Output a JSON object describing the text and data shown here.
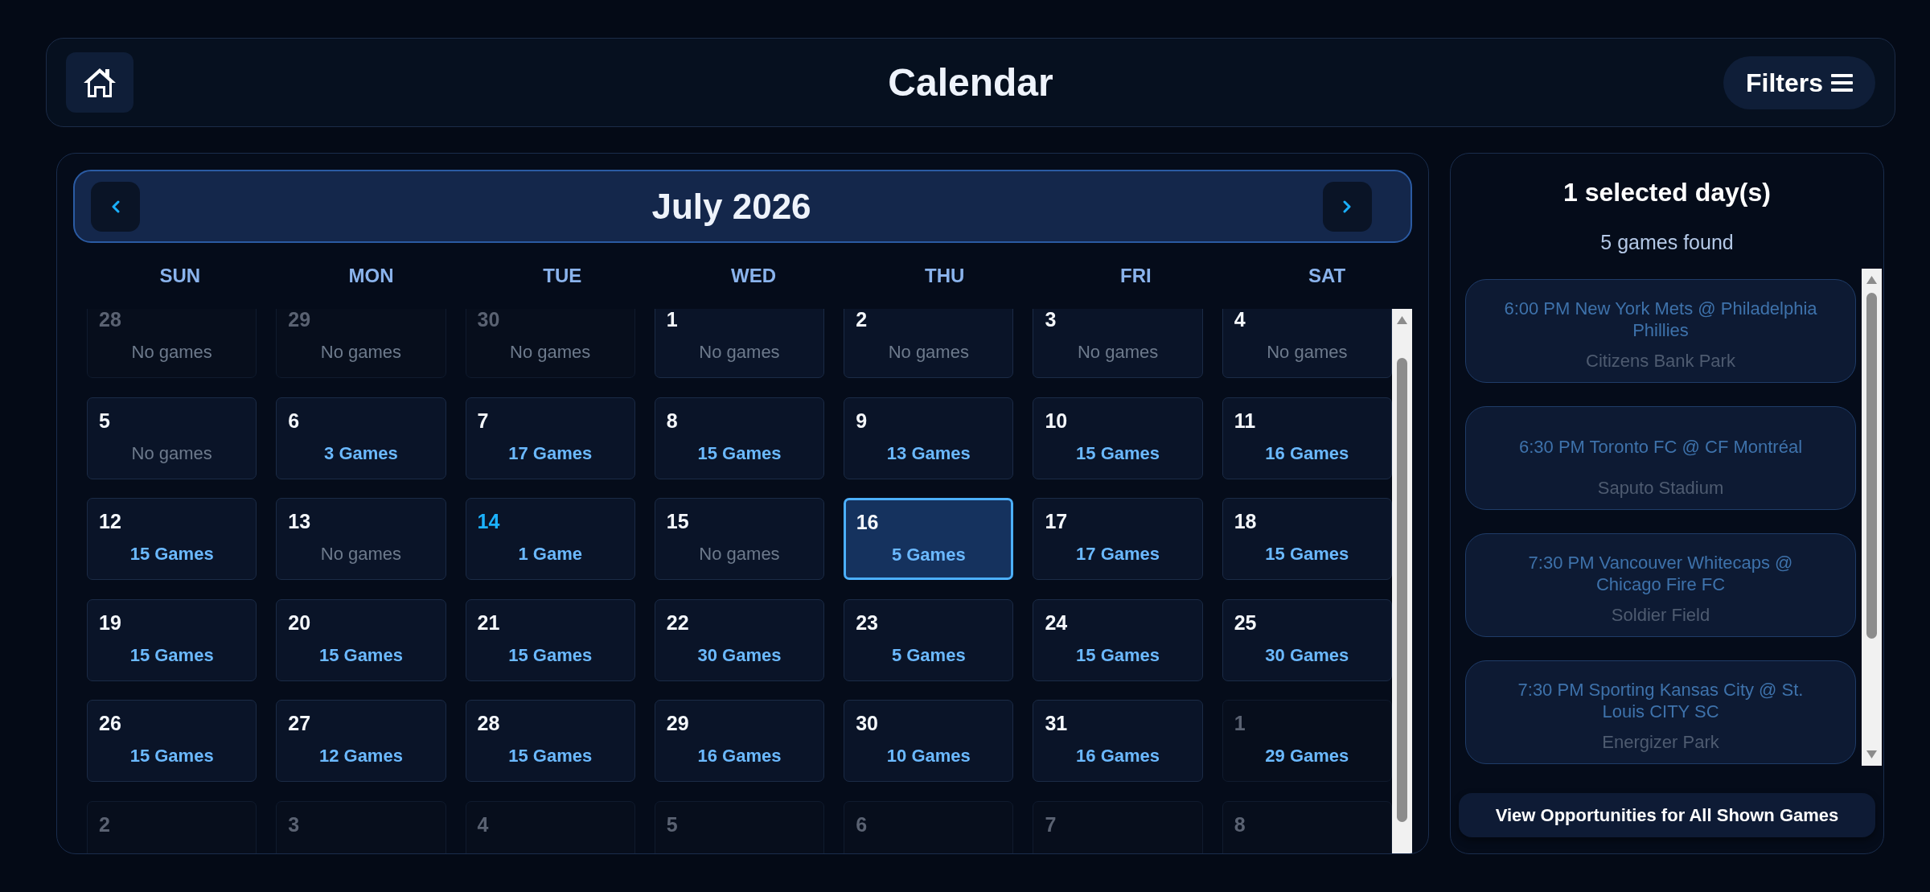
{
  "header": {
    "title": "Calendar",
    "filters_label": "Filters"
  },
  "calendar": {
    "month": "July 2026",
    "weekdays": [
      "SUN",
      "MON",
      "TUE",
      "WED",
      "THU",
      "FRI",
      "SAT"
    ],
    "weeks": [
      [
        {
          "day": "28",
          "games": "No games",
          "has_games": false,
          "in_month": false,
          "today": false,
          "selected": false
        },
        {
          "day": "29",
          "games": "No games",
          "has_games": false,
          "in_month": false,
          "today": false,
          "selected": false
        },
        {
          "day": "30",
          "games": "No games",
          "has_games": false,
          "in_month": false,
          "today": false,
          "selected": false
        },
        {
          "day": "1",
          "games": "No games",
          "has_games": false,
          "in_month": true,
          "today": false,
          "selected": false
        },
        {
          "day": "2",
          "games": "No games",
          "has_games": false,
          "in_month": true,
          "today": false,
          "selected": false
        },
        {
          "day": "3",
          "games": "No games",
          "has_games": false,
          "in_month": true,
          "today": false,
          "selected": false
        },
        {
          "day": "4",
          "games": "No games",
          "has_games": false,
          "in_month": true,
          "today": false,
          "selected": false
        }
      ],
      [
        {
          "day": "5",
          "games": "No games",
          "has_games": false,
          "in_month": true,
          "today": false,
          "selected": false
        },
        {
          "day": "6",
          "games": "3 Games",
          "has_games": true,
          "in_month": true,
          "today": false,
          "selected": false
        },
        {
          "day": "7",
          "games": "17 Games",
          "has_games": true,
          "in_month": true,
          "today": false,
          "selected": false
        },
        {
          "day": "8",
          "games": "15 Games",
          "has_games": true,
          "in_month": true,
          "today": false,
          "selected": false
        },
        {
          "day": "9",
          "games": "13 Games",
          "has_games": true,
          "in_month": true,
          "today": false,
          "selected": false
        },
        {
          "day": "10",
          "games": "15 Games",
          "has_games": true,
          "in_month": true,
          "today": false,
          "selected": false
        },
        {
          "day": "11",
          "games": "16 Games",
          "has_games": true,
          "in_month": true,
          "today": false,
          "selected": false
        }
      ],
      [
        {
          "day": "12",
          "games": "15 Games",
          "has_games": true,
          "in_month": true,
          "today": false,
          "selected": false
        },
        {
          "day": "13",
          "games": "No games",
          "has_games": false,
          "in_month": true,
          "today": false,
          "selected": false
        },
        {
          "day": "14",
          "games": "1 Game",
          "has_games": true,
          "in_month": true,
          "today": true,
          "selected": false
        },
        {
          "day": "15",
          "games": "No games",
          "has_games": false,
          "in_month": true,
          "today": false,
          "selected": false
        },
        {
          "day": "16",
          "games": "5 Games",
          "has_games": true,
          "in_month": true,
          "today": false,
          "selected": true
        },
        {
          "day": "17",
          "games": "17 Games",
          "has_games": true,
          "in_month": true,
          "today": false,
          "selected": false
        },
        {
          "day": "18",
          "games": "15 Games",
          "has_games": true,
          "in_month": true,
          "today": false,
          "selected": false
        }
      ],
      [
        {
          "day": "19",
          "games": "15 Games",
          "has_games": true,
          "in_month": true,
          "today": false,
          "selected": false
        },
        {
          "day": "20",
          "games": "15 Games",
          "has_games": true,
          "in_month": true,
          "today": false,
          "selected": false
        },
        {
          "day": "21",
          "games": "15 Games",
          "has_games": true,
          "in_month": true,
          "today": false,
          "selected": false
        },
        {
          "day": "22",
          "games": "30 Games",
          "has_games": true,
          "in_month": true,
          "today": false,
          "selected": false
        },
        {
          "day": "23",
          "games": "5 Games",
          "has_games": true,
          "in_month": true,
          "today": false,
          "selected": false
        },
        {
          "day": "24",
          "games": "15 Games",
          "has_games": true,
          "in_month": true,
          "today": false,
          "selected": false
        },
        {
          "day": "25",
          "games": "30 Games",
          "has_games": true,
          "in_month": true,
          "today": false,
          "selected": false
        }
      ],
      [
        {
          "day": "26",
          "games": "15 Games",
          "has_games": true,
          "in_month": true,
          "today": false,
          "selected": false
        },
        {
          "day": "27",
          "games": "12 Games",
          "has_games": true,
          "in_month": true,
          "today": false,
          "selected": false
        },
        {
          "day": "28",
          "games": "15 Games",
          "has_games": true,
          "in_month": true,
          "today": false,
          "selected": false
        },
        {
          "day": "29",
          "games": "16 Games",
          "has_games": true,
          "in_month": true,
          "today": false,
          "selected": false
        },
        {
          "day": "30",
          "games": "10 Games",
          "has_games": true,
          "in_month": true,
          "today": false,
          "selected": false
        },
        {
          "day": "31",
          "games": "16 Games",
          "has_games": true,
          "in_month": true,
          "today": false,
          "selected": false
        },
        {
          "day": "1",
          "games": "29 Games",
          "has_games": true,
          "in_month": false,
          "today": false,
          "selected": false
        }
      ],
      [
        {
          "day": "2",
          "in_month": false,
          "today": false,
          "selected": false
        },
        {
          "day": "3",
          "in_month": false,
          "today": false,
          "selected": false
        },
        {
          "day": "4",
          "in_month": false,
          "today": false,
          "selected": false
        },
        {
          "day": "5",
          "in_month": false,
          "today": false,
          "selected": false
        },
        {
          "day": "6",
          "in_month": false,
          "today": false,
          "selected": false
        },
        {
          "day": "7",
          "in_month": false,
          "today": false,
          "selected": false
        },
        {
          "day": "8",
          "in_month": false,
          "today": false,
          "selected": false
        }
      ]
    ]
  },
  "sidebar": {
    "title": "1 selected day(s)",
    "summary": "5 games found",
    "games": [
      {
        "title": "6:00 PM New York Mets @ Philadelphia Phillies",
        "venue": "Citizens Bank Park"
      },
      {
        "title": "6:30 PM Toronto FC @ CF Montréal",
        "venue": "Saputo Stadium"
      },
      {
        "title": "7:30 PM Vancouver Whitecaps @ Chicago Fire FC",
        "venue": "Soldier Field"
      },
      {
        "title": "7:30 PM Sporting Kansas City @ St. Louis CITY SC",
        "venue": "Energizer Park"
      }
    ],
    "button": "View Opportunities for All Shown Games"
  }
}
